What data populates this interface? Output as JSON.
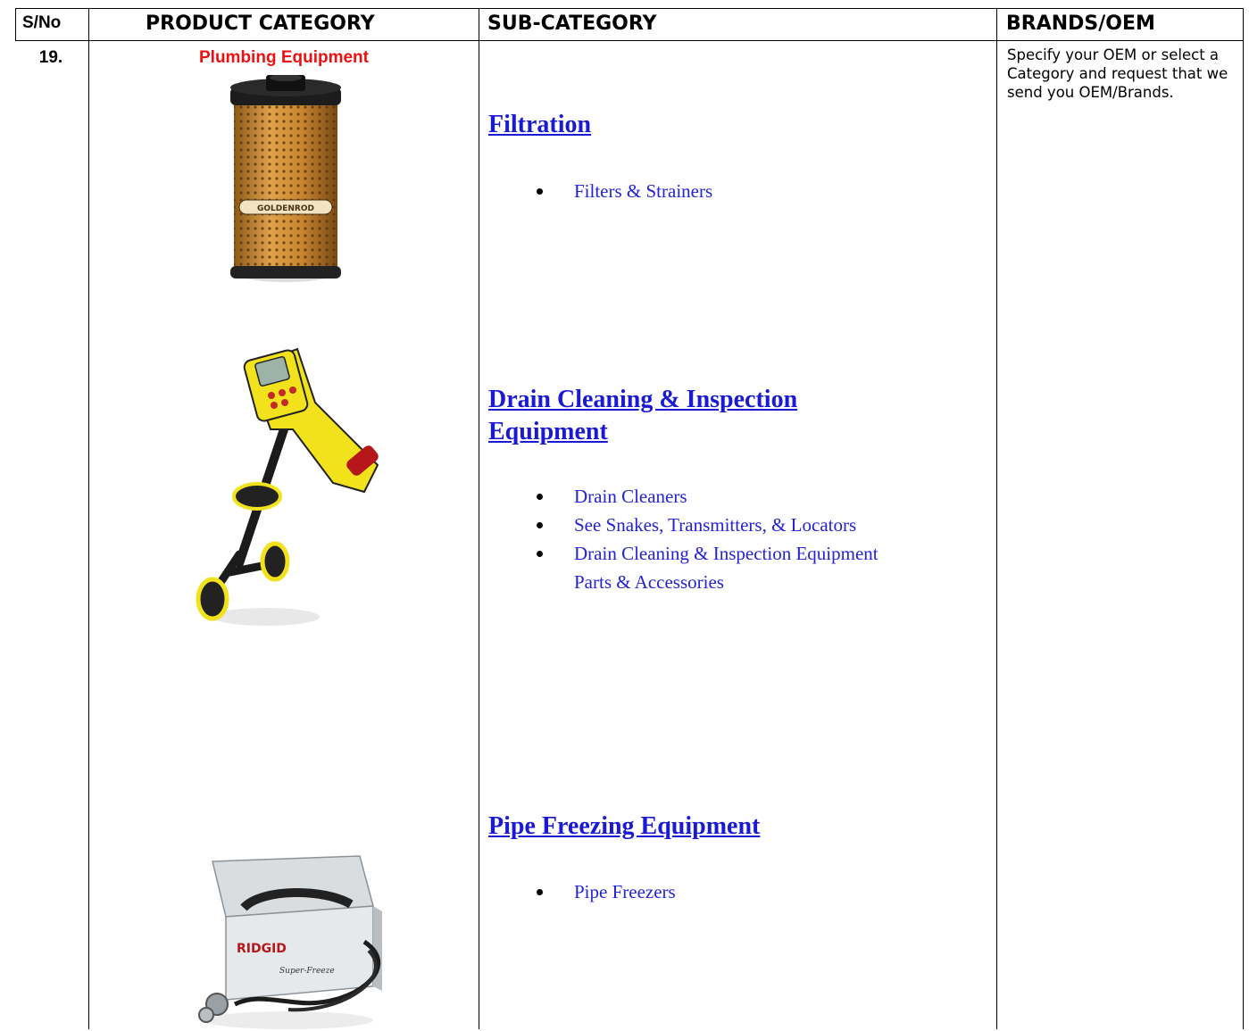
{
  "table": {
    "headers": {
      "sno": "S/No",
      "product_category": "PRODUCT CATEGORY",
      "sub_category": "SUB-CATEGORY",
      "brands": "BRANDS/OEM"
    },
    "row": {
      "sno": "19.",
      "category": "Plumbing Equipment",
      "brands_note": "Specify your OEM or select a Category and request that we send you OEM/Brands.",
      "subcategories": [
        {
          "title_line1": "Filtration",
          "title_line2": "",
          "items": [
            "Filters & Strainers"
          ]
        },
        {
          "title_line1": "Drain Cleaning & Inspection",
          "title_line2": "Equipment",
          "items": [
            "Drain Cleaners",
            "See Snakes, Transmitters, & Locators",
            "Drain Cleaning & Inspection Equipment",
            "Parts & Accessories"
          ]
        },
        {
          "title_line1": "Pipe Freezing Equipment",
          "title_line2": "",
          "items": [
            "Pipe Freezers"
          ]
        }
      ],
      "images": [
        {
          "label": "GOLDENROD"
        },
        {
          "label": ""
        },
        {
          "label": "RIDGID",
          "label2": "Super-Freeze"
        }
      ]
    }
  },
  "colors": {
    "category_red": "#ee1010",
    "link_blue": "#1a1ad4",
    "filter_gold": "#c98a2e",
    "locator_yellow": "#f2e21c"
  }
}
